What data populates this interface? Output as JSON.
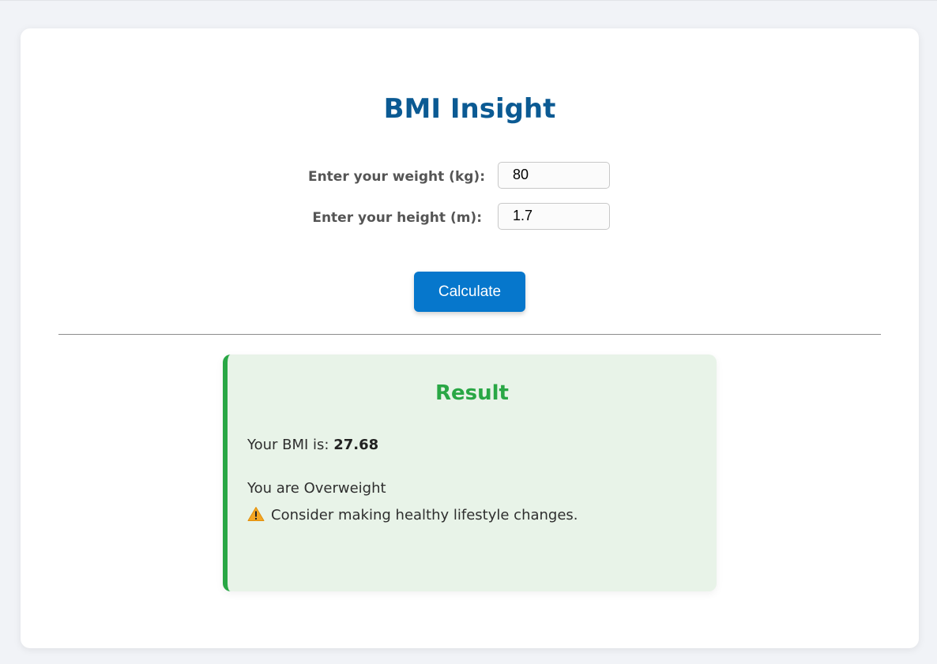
{
  "app": {
    "title": "BMI Insight"
  },
  "form": {
    "weight": {
      "label": "Enter your weight (kg):",
      "value": "80"
    },
    "height": {
      "label": "Enter your height (m):",
      "value": "1.7"
    },
    "calculate_label": "Calculate"
  },
  "result": {
    "title": "Result",
    "bmi_prefix": "Your BMI is: ",
    "bmi_value": "27.68",
    "category_text": "You are Overweight",
    "advice_text": "Consider making healthy lifestyle changes.",
    "advice_icon": "warning-icon"
  },
  "colors": {
    "page_background": "#f1f3f7",
    "title": "#0b5a93",
    "button": "#0677cc",
    "result_accent": "#29a745",
    "result_background": "#e8f3e8",
    "warning": "#f5a623"
  }
}
